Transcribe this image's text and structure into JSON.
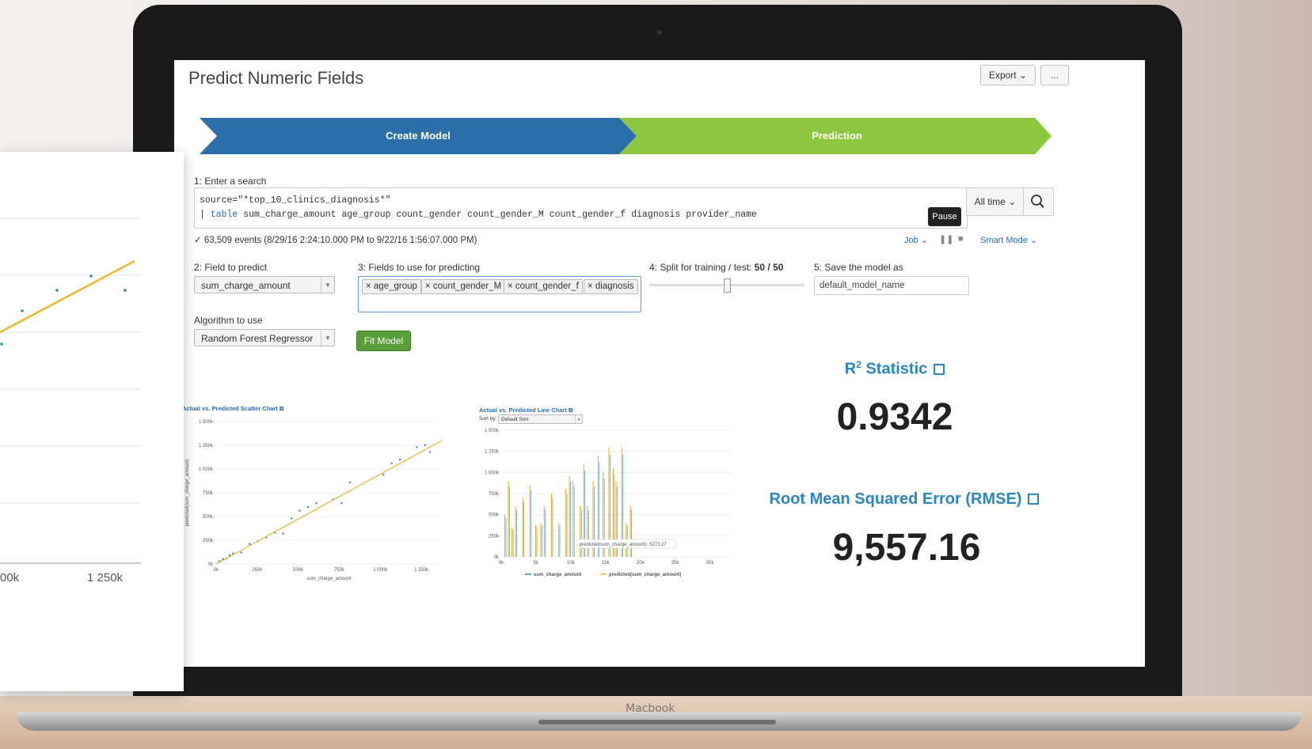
{
  "page": {
    "title": "Predict Numeric Fields",
    "export_label": "Export ⌄",
    "more_label": "..."
  },
  "steps": {
    "create": "Create Model",
    "prediction": "Prediction"
  },
  "search": {
    "label": "1: Enter a search",
    "line1": "source=\"*top_10_clinics_diagnosis*\"",
    "line2_prefix": "| ",
    "line2_kw": "table",
    "line2_rest": " sum_charge_amount age_group count_gender count_gender_M count_gender_f diagnosis provider_name",
    "time_label": "All time ⌄",
    "tooltip": "Pause",
    "events": "✓ 63,509 events (8/29/16 2:24:10.000 PM to 9/22/16 1:56:07.000 PM)",
    "job_label": "Job ⌄",
    "smart_mode": "Smart Mode ⌄"
  },
  "form": {
    "field_label": "2: Field to predict",
    "field_value": "sum_charge_amount",
    "fields_label": "3: Fields to use for predicting",
    "tags": [
      "× age_group",
      "× count_gender_M",
      "× count_gender_f",
      "× diagnosis"
    ],
    "split_label": "4: Split for training / test: ",
    "split_value": "50 / 50",
    "save_label": "5: Save the model as",
    "save_value": "default_model_name",
    "algo_label": "Algorithm to use",
    "algo_value": "Random Forest Regressor",
    "fit_label": "Fit Model"
  },
  "stats": {
    "r2_title": "R",
    "r2_sup": "2",
    "r2_suffix": " Statistic",
    "r2_value": "0.9342",
    "rmse_title": "Root Mean Squared Error (RMSE)",
    "rmse_value": "9,557.16"
  },
  "laptop": {
    "brand": "Macbook"
  },
  "colors": {
    "accent_blue": "#2a6fa8",
    "accent_green": "#8dc63f",
    "fit_green": "#5a9e3a",
    "line_orange": "#f0b429"
  },
  "chart_data": [
    {
      "type": "scatter",
      "title": "Actual vs. Predicted Scatter Chart",
      "xlabel": "sum_charge_amount",
      "ylabel": "predicted(sum_charge_amount)",
      "x_ticks": [
        "0k",
        "250k",
        "500k",
        "750k",
        "1 000k",
        "1 250k"
      ],
      "y_ticks": [
        "0k",
        "250k",
        "500k",
        "750k",
        "1 000k",
        "1 250k",
        "1 500k"
      ],
      "xlim": [
        0,
        1350000
      ],
      "ylim": [
        0,
        1500000
      ],
      "points": [
        [
          20000,
          30000
        ],
        [
          40000,
          50000
        ],
        [
          60000,
          55000
        ],
        [
          80000,
          90000
        ],
        [
          100000,
          110000
        ],
        [
          150000,
          120000
        ],
        [
          200000,
          210000
        ],
        [
          250000,
          240000
        ],
        [
          300000,
          280000
        ],
        [
          350000,
          330000
        ],
        [
          400000,
          320000
        ],
        [
          450000,
          480000
        ],
        [
          500000,
          560000
        ],
        [
          550000,
          600000
        ],
        [
          600000,
          640000
        ],
        [
          700000,
          680000
        ],
        [
          750000,
          640000
        ],
        [
          800000,
          860000
        ],
        [
          1000000,
          940000
        ],
        [
          1050000,
          1060000
        ],
        [
          1100000,
          1100000
        ],
        [
          1200000,
          1230000
        ],
        [
          1250000,
          1250000
        ],
        [
          1280000,
          1180000
        ]
      ],
      "fit_line": [
        [
          0,
          0
        ],
        [
          1350000,
          1300000
        ]
      ]
    },
    {
      "type": "line",
      "title": "Actual vs. Predicted Line Chart",
      "sort_label": "Sort by:",
      "sort_value": "Default Sort",
      "x_ticks": [
        "0k",
        "5k",
        "10k",
        "15k",
        "20k",
        "25k",
        "30k"
      ],
      "y_ticks": [
        "0k",
        "250k",
        "500k",
        "750k",
        "1 000k",
        "1 250k",
        "1 500k"
      ],
      "xlim": [
        0,
        32000
      ],
      "ylim": [
        0,
        1500000
      ],
      "series": [
        {
          "name": "sum_charge_amount",
          "color": "#2a86c2"
        },
        {
          "name": "predicted(sum_charge_amount)",
          "color": "#f0b429"
        }
      ],
      "spikes_x": [
        500,
        1000,
        1500,
        2000,
        3000,
        4000,
        4800,
        5500,
        6000,
        7000,
        8000,
        9000,
        9500,
        10000,
        11000,
        11500,
        12000,
        12800,
        13500,
        14200,
        15000,
        15600,
        16000,
        16800,
        17400,
        18000
      ],
      "spikes_y": [
        500000,
        900000,
        350000,
        600000,
        700000,
        850000,
        380000,
        400000,
        600000,
        750000,
        400000,
        800000,
        960000,
        900000,
        600000,
        1100000,
        600000,
        900000,
        1200000,
        1000000,
        1300000,
        1050000,
        900000,
        1300000,
        400000,
        600000
      ],
      "tooltip": "predicted(sum_charge_amount): 5273.27"
    },
    {
      "type": "line",
      "title": "",
      "x_ticks": [
        "00k",
        "1 250k"
      ],
      "points": [
        [
          0,
          420
        ],
        [
          1,
          380
        ],
        [
          2,
          330
        ],
        [
          3,
          290
        ],
        [
          4,
          260
        ]
      ]
    }
  ]
}
